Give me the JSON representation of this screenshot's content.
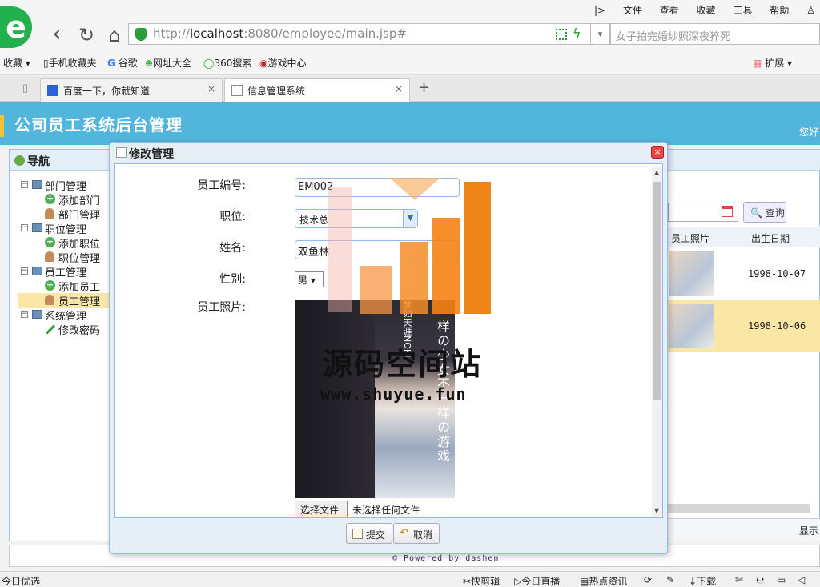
{
  "browser": {
    "url_prefix": "http://",
    "url_host": "localhost",
    "url_rest": ":8080/employee/main.jsp#",
    "search_text": "女子拍完婚纱照深夜猝死",
    "menu": [
      "|>",
      "文件",
      "查看",
      "收藏",
      "工具",
      "帮助"
    ],
    "bookmarks": [
      "收藏",
      "手机收藏夹",
      "谷歌",
      "网址大全",
      "360搜索",
      "游戏中心",
      "扩展"
    ],
    "tabs": [
      {
        "label": "百度一下，你就知道",
        "close": "×"
      },
      {
        "label": "信息管理系统",
        "close": "×"
      }
    ],
    "new_tab": "+"
  },
  "app": {
    "title": "公司员工系统后台管理",
    "greeting": "您好",
    "nav_title": "导航",
    "nav": [
      {
        "label": "部门管理",
        "level": 0
      },
      {
        "label": "添加部门",
        "level": 1
      },
      {
        "label": "部门管理",
        "level": 1
      },
      {
        "label": "职位管理",
        "level": 0
      },
      {
        "label": "添加职位",
        "level": 1
      },
      {
        "label": "职位管理",
        "level": 1
      },
      {
        "label": "员工管理",
        "level": 0
      },
      {
        "label": "添加员工",
        "level": 1
      },
      {
        "label": "员工管理",
        "level": 1,
        "selected": true
      },
      {
        "label": "系统管理",
        "level": 0
      },
      {
        "label": "修改密码",
        "level": 1
      }
    ],
    "query_button": "查询",
    "grid_columns": [
      "员工照片",
      "出生日期"
    ],
    "grid_rows": [
      {
        "dob": "1998-10-07"
      },
      {
        "dob": "1998-10-06"
      }
    ],
    "grid_footer": "显示",
    "powered_by": "© Powered by dashen"
  },
  "dialog": {
    "title": "修改管理",
    "close": "×",
    "fields": {
      "emp_no_label": "员工编号:",
      "emp_no_value": "EM002",
      "position_label": "职位:",
      "position_value": "技术总",
      "name_label": "姓名:",
      "name_value": "双鱼林",
      "gender_label": "性别:",
      "gender_value": "男 ▾",
      "photo_label": "员工照片:",
      "photo_text_vertical": "样の少女不一样の游戏",
      "photo_text_small": "梦如天涯NOKI"
    },
    "file_button": "选择文件",
    "file_status": "未选择任何文件",
    "submit": "提交",
    "cancel": "取消"
  },
  "watermark": {
    "title": "源码空间站",
    "url": "www.shuyue.fun"
  },
  "statusbar": {
    "left": "今日优选",
    "items": [
      "快剪辑",
      "今日直播",
      "热点资讯",
      "下载"
    ]
  },
  "colors": {
    "header_blue": "#52b6dc",
    "selected_row": "#fbe7a5",
    "border_blue": "#95b8e7"
  }
}
